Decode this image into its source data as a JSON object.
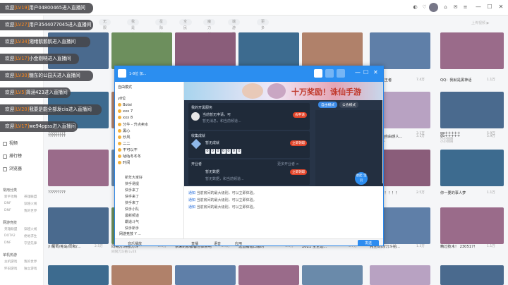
{
  "window": {
    "close": "✕",
    "max": "☐",
    "min": "—"
  },
  "categories": [
    "无限捣蛋",
    "我是大哥",
    "星际战人",
    "全民PK",
    "魔力新服",
    "端游同服",
    "更多"
  ],
  "categories_right": "上传视频 ▶",
  "sidebar": {
    "nav": [
      {
        "label": "视频",
        "icon": "video-icon"
      },
      {
        "label": "排行榜",
        "icon": "rank-icon"
      },
      {
        "label": "浏览器",
        "icon": "browser-icon"
      }
    ],
    "sections": [
      {
        "title": "常用分类",
        "items": [
          "新手攻略",
          "英雄联盟",
          "DNF",
          "穿越火线",
          "DNF",
          "我的世界"
        ]
      },
      {
        "title": "网游竞技",
        "items": [
          "英雄联盟",
          "穿越火线",
          "DOTA2",
          "绝地求生",
          "DNF",
          "守望先锋"
        ]
      },
      {
        "title": "单机热游",
        "items": [
          "主机游戏",
          "我的世界",
          "怀旧游戏",
          "独立游戏"
        ]
      }
    ]
  },
  "notices": [
    {
      "pre": "欢迎",
      "lv": "[LV19]",
      "name": "用户04800465",
      "post": "进入直播间"
    },
    {
      "pre": "欢迎",
      "lv": "[LV27]",
      "name": "用户3544077045",
      "post": "进入直播间"
    },
    {
      "pre": "欢迎",
      "lv": "[LV34]",
      "name": "湘绪鹅鹅鹅",
      "post": "进入直播间"
    },
    {
      "pre": "欢迎",
      "lv": "[LV17]",
      "name": "小金刚呐",
      "post": "进入直播间"
    },
    {
      "pre": "欢迎",
      "lv": "[LV30]",
      "name": "糖东的公园天",
      "post": "进入直播间"
    },
    {
      "pre": "欢迎",
      "lv": "[LV5]",
      "name": "简涵423",
      "post": "进入直播间"
    },
    {
      "pre": "欢迎",
      "lv": "[LV20]",
      "name": "我要是能全部发cia",
      "post": "进入直播间"
    },
    {
      "pre": "欢迎",
      "lv": "[LV17]",
      "name": "we94ppss",
      "post": "进入直播间"
    }
  ],
  "thumb_rows": [
    {
      "l1": [
        "?????????",
        "",
        "",
        "",
        "",
        "",
        "gp+++++"
      ],
      "r": [
        "",
        "",
        "",
        "",
        "",
        "3.1万",
        "5.9万"
      ],
      "l2": [
        "",
        "",
        "",
        "",
        "",
        "YUUTNQL",
        "小小帅哥"
      ]
    },
    {
      "l1": [
        "",
        "",
        "",
        "",
        "",
        "进化最强王者",
        "QQ：我就是黑神话"
      ],
      "r": [
        "",
        "",
        "",
        "",
        "",
        "7.4万",
        "1.1万"
      ],
      "l2": [
        "",
        "",
        "",
        "",
        "",
        "",
        ""
      ]
    },
    {
      "l1": [
        "?????????",
        "",
        "",
        "",
        "",
        "同情人的自由感人...",
        "go+++++"
      ],
      "r": [
        "",
        "",
        "",
        "",
        "",
        "3.1万",
        "5.9万"
      ],
      "l2": [
        "",
        "",
        "",
        "",
        "",
        "YUUTNQL",
        "小小帅哥"
      ]
    },
    {
      "l1": [
        "?????????",
        "",
        "",
        "",
        "",
        "斗斗！！！！！！",
        "你一要的事人梦"
      ],
      "r": [
        "",
        "",
        "",
        "",
        "",
        "2.5万",
        "1.1万"
      ],
      "l2": [
        "",
        "",
        "",
        "",
        "",
        "",
        ""
      ]
    },
    {
      "l1": [
        "川葡萄/羌岛/同和/...",
        "同哥刀斗拍/刀斗",
        "依来的那都备合律照吧",
        "送直播隆口顺时",
        "2021 全全选...",
        "完全同同/刀斗拍...",
        "精过技木！ 230517！"
      ],
      "r": [
        "2.5万",
        "2.1万",
        "2.4万",
        "1.1万",
        "6.7万",
        "1.3万",
        "1.1万"
      ],
      "l2": [
        "",
        "同同刀斗拍 Lv24",
        "",
        "",
        "",
        "",
        ""
      ]
    }
  ],
  "popup": {
    "room_title": "1-8位 加...",
    "left_header": "自由模式",
    "left_channel": "y8位",
    "members": [
      "Bolai",
      "xxx 7",
      "xxx 8",
      "分牛 - 升点卖水",
      "黑心",
      "炒风",
      "二二",
      "不可以不",
      "咕咕冬冬冬",
      "时间"
    ],
    "members_right": [
      "",
      "",
      "",
      "",
      "",
      "",
      "",
      "",
      "",
      ""
    ],
    "sub_channels": [
      "新年大家好",
      "快手易提",
      "快手来了",
      "快手来了",
      "快手来了",
      "快手小队",
      "最新频道",
      "霸道斗气",
      "快手新手"
    ],
    "left_footer": "网游竞技 Y ...",
    "banner_text": "十万奖励！诛仙手游",
    "segments": [
      "自由模式",
      "公会模式"
    ],
    "panel1": {
      "title": "我的开黑服务",
      "user": "当前暂无申请，可",
      "line2": "暂无消息，和当前频道...",
      "btn": "去申请"
    },
    "panel2": {
      "title": "收集成就",
      "sub": "暂无成就",
      "btn": "立即领取",
      "digits": [
        "0",
        "0",
        "0",
        "0",
        "0",
        "0",
        "0"
      ]
    },
    "panel3": {
      "title": "开业者",
      "more": "更多开业者 >",
      "sub": "暂无数据",
      "btn": "立即领取",
      "line": "暂无数据，和当前频道..."
    },
    "collapse_btn": "收起\n宝贝",
    "chat": [
      {
        "who": "通知",
        "text": "当前房间的最大级别，可以立即体验。"
      },
      {
        "who": "通知",
        "text": "当前房间的最大级别，可以立即体验。"
      },
      {
        "who": "通知",
        "text": "当前房间的最大级别，可以立即体验。"
      }
    ],
    "footer": {
      "items": [
        "音乐播放",
        "直播",
        "语音",
        "应用"
      ],
      "send": "发送"
    }
  }
}
